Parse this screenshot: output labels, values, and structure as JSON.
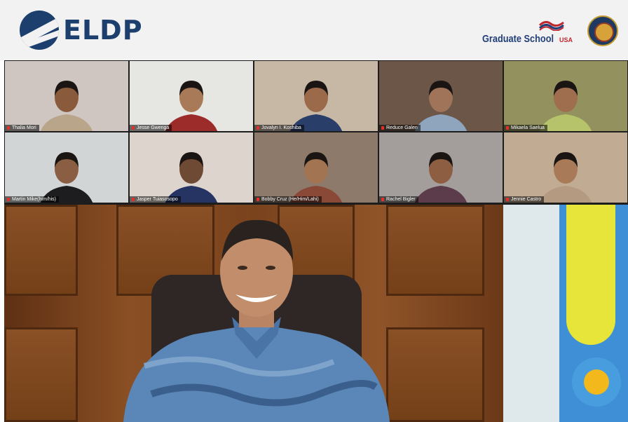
{
  "header": {
    "left_logo_text": "ELDP",
    "right_logo_text": "Graduate School",
    "right_logo_suffix": "USA",
    "seal": "government-seal-icon"
  },
  "participants": [
    {
      "name": "Thalia Mori",
      "bg": "#cfc6c2",
      "skin": "#8a5a3c",
      "shirt": "#b9a58a",
      "hair": "#1a1412"
    },
    {
      "name": "Jesse Gwenga",
      "bg": "#e6e6e3",
      "skin": "#a87a58",
      "shirt": "#9c2c2a",
      "hair": "#1a1412"
    },
    {
      "name": "Jovalyn I. Koshiba",
      "bg": "#c7b8a6",
      "skin": "#9b6a4a",
      "shirt": "#2a3e6a",
      "hair": "#1a1412"
    },
    {
      "name": "Reduce Galen",
      "bg": "#6b5648",
      "skin": "#a07458",
      "shirt": "#8fa4bd",
      "hair": "#1a1412"
    },
    {
      "name": "Mikaela Saelua",
      "bg": "#93915e",
      "skin": "#9e6e4e",
      "shirt": "#b7c36a",
      "hair": "#1a1412"
    },
    {
      "name": "Martin Mike(him/his)",
      "bg": "#d2d5d6",
      "skin": "#8a5e42",
      "shirt": "#1d1d20",
      "hair": "#1a1412"
    },
    {
      "name": "Jasper Tuiasosopo",
      "bg": "#ddd5cd",
      "skin": "#6e4a34",
      "shirt": "#253463",
      "hair": "#1a1412"
    },
    {
      "name": "Bobby Cruz (He/Him/Lahi)",
      "bg": "#8e7a6a",
      "skin": "#a27452",
      "shirt": "#8a4836",
      "hair": "#1a1412"
    },
    {
      "name": "Rachel Bigler",
      "bg": "#a39e9b",
      "skin": "#8e5e42",
      "shirt": "#5c3b4a",
      "hair": "#1a1412"
    },
    {
      "name": "Jennie Castro",
      "bg": "#c2ab93",
      "skin": "#a87a58",
      "shirt": "#b39a80",
      "hair": "#1a1412"
    }
  ],
  "main_speaker": {
    "icon": "record-button-icon"
  }
}
